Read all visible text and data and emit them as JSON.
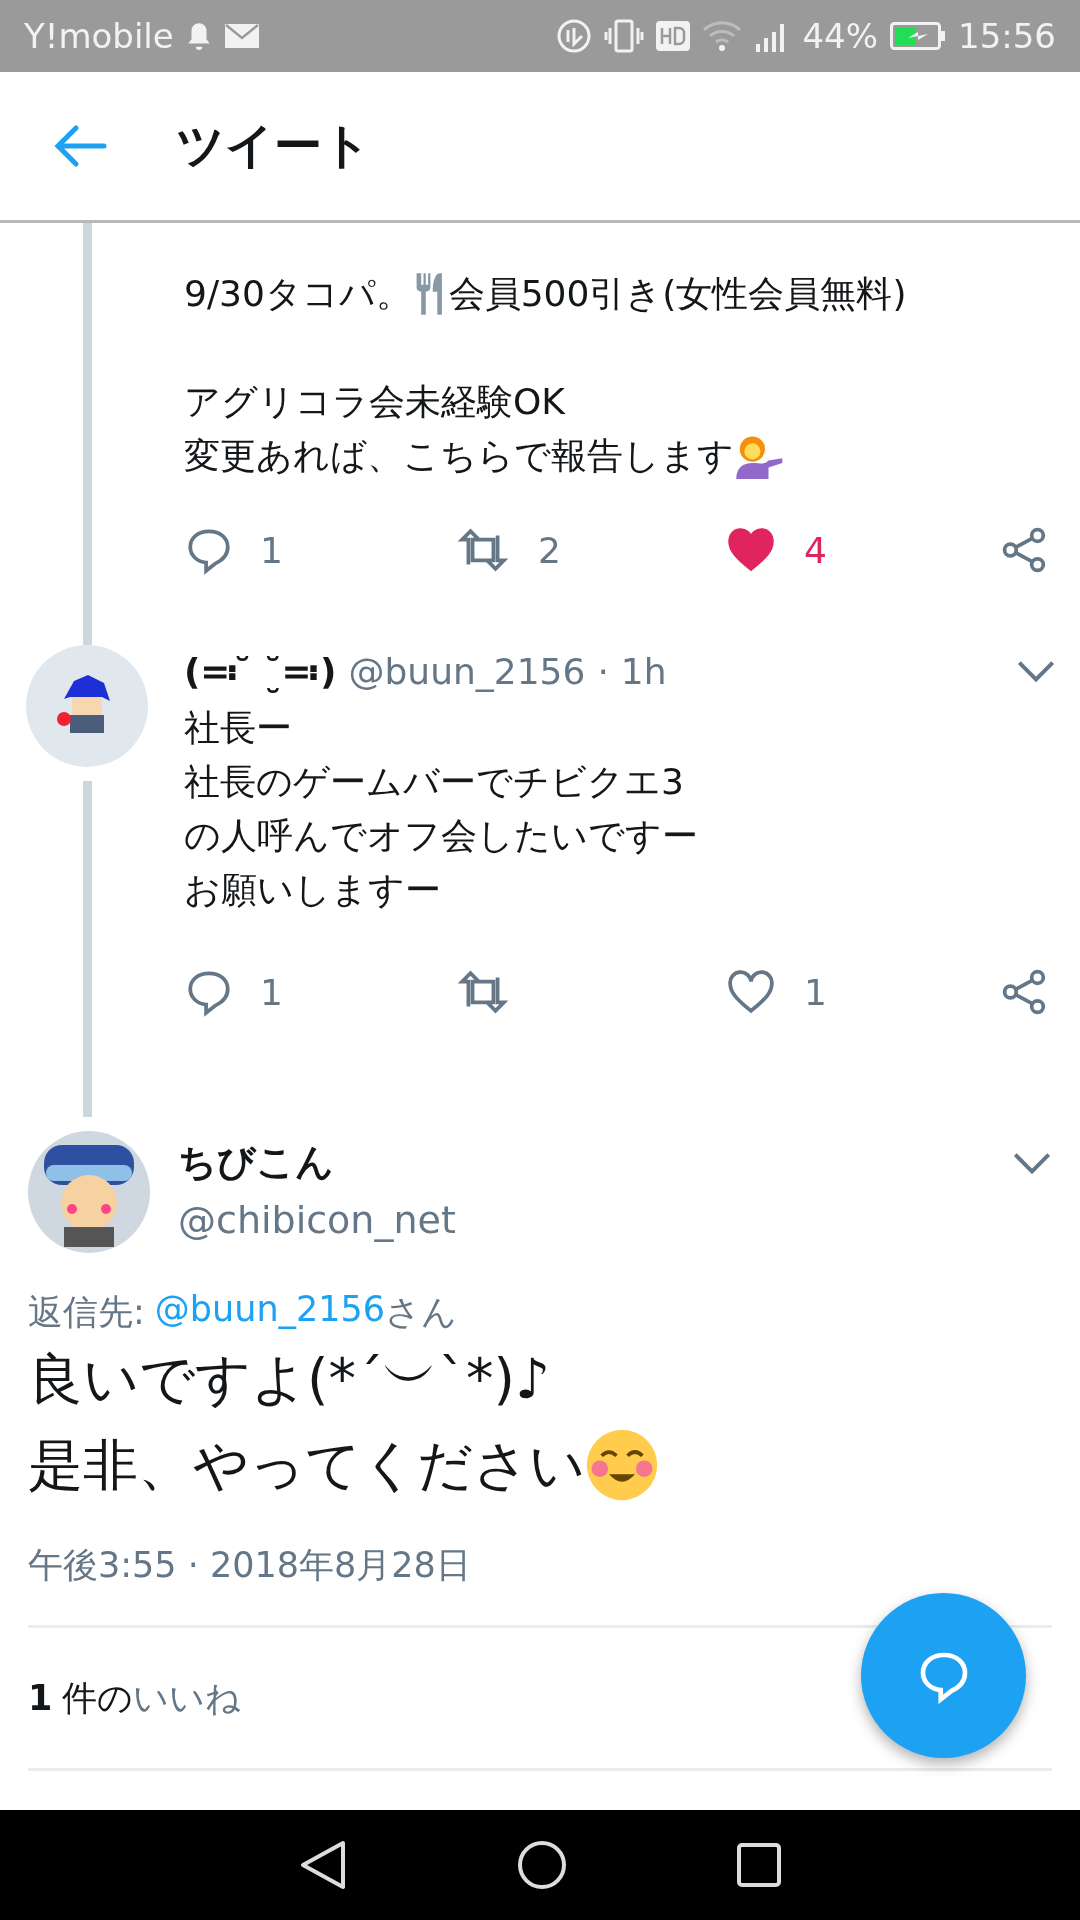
{
  "status_bar": {
    "carrier": "Y!mobile",
    "battery": "44%",
    "time": "15:56"
  },
  "header": {
    "title": "ツイート"
  },
  "thread": [
    {
      "kind": "continued",
      "paragraphs": [
        [
          [
            {
              "kind": "text",
              "text": "9/30タコパ。"
            },
            {
              "kind": "cutlery"
            },
            {
              "kind": "text",
              "text": "会員500引き(女性会員無料)"
            }
          ]
        ],
        [
          [
            {
              "kind": "text",
              "text": "アグリコラ会未経験OK"
            }
          ],
          [
            {
              "kind": "text",
              "text": "変更あれば、こちらで報告します"
            },
            {
              "kind": "gesture"
            }
          ]
        ]
      ],
      "actions": {
        "replies": "1",
        "retweets": "2",
        "likes": "4",
        "liked": true
      }
    },
    {
      "kind": "reply",
      "display_name": "(≕ ̆ ˘̮≕)",
      "handle": "@buun_2156",
      "separator": "·",
      "time": "1h",
      "paragraphs": [
        [
          [
            {
              "kind": "text",
              "text": "社長ー"
            }
          ],
          [
            {
              "kind": "text",
              "text": "社長のゲームバーでチビクエ3"
            }
          ],
          [
            {
              "kind": "text",
              "text": "の人呼んでオフ会したいですー"
            }
          ],
          [
            {
              "kind": "text",
              "text": "お願いしますー"
            }
          ]
        ]
      ],
      "actions": {
        "replies": "1",
        "likes": "1",
        "liked": false
      }
    }
  ],
  "focus_tweet": {
    "display_name": "ちびこん",
    "handle": "@chibicon_net",
    "reply_to_label": "返信先:",
    "reply_to_handle": "@buun_2156",
    "reply_to_suffix": "さん",
    "lines": [
      [
        {
          "kind": "text",
          "text": "良いですよ(*´︶`*)♪"
        }
      ],
      [
        {
          "kind": "text",
          "text": "是非、やってください"
        },
        {
          "kind": "smiley"
        }
      ]
    ],
    "timestamp": "午後3:55 · 2018年8月28日",
    "likes_count": "1",
    "likes_mid": "件の",
    "likes_label": "いいね"
  }
}
